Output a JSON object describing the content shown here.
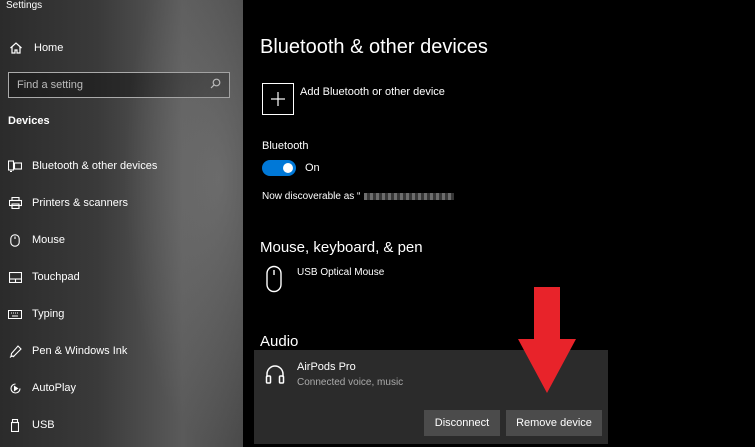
{
  "window": {
    "title": "Settings"
  },
  "sidebar": {
    "home_label": "Home",
    "search_placeholder": "Find a setting",
    "section_header": "Devices",
    "items": [
      {
        "label": "Bluetooth & other devices",
        "icon": "bluetooth-devices-icon",
        "active": true
      },
      {
        "label": "Printers & scanners",
        "icon": "printer-icon"
      },
      {
        "label": "Mouse",
        "icon": "mouse-icon"
      },
      {
        "label": "Touchpad",
        "icon": "touchpad-icon"
      },
      {
        "label": "Typing",
        "icon": "keyboard-icon"
      },
      {
        "label": "Pen & Windows Ink",
        "icon": "pen-icon"
      },
      {
        "label": "AutoPlay",
        "icon": "autoplay-icon"
      },
      {
        "label": "USB",
        "icon": "usb-icon"
      }
    ]
  },
  "main": {
    "title": "Bluetooth & other devices",
    "add_device_label": "Add Bluetooth or other device",
    "bluetooth": {
      "label": "Bluetooth",
      "toggle_state": "On",
      "discoverable_prefix": "Now discoverable as “"
    },
    "mouse_section": {
      "heading": "Mouse, keyboard, & pen",
      "device_name": "USB Optical Mouse"
    },
    "audio_section": {
      "heading": "Audio",
      "device_name": "AirPods Pro",
      "device_status": "Connected voice, music",
      "disconnect_label": "Disconnect",
      "remove_label": "Remove device"
    }
  },
  "colors": {
    "accent": "#0078d7",
    "annotation_arrow": "#e8232a",
    "card_bg": "#2b2b2b",
    "button_bg": "#4b4b4b"
  }
}
